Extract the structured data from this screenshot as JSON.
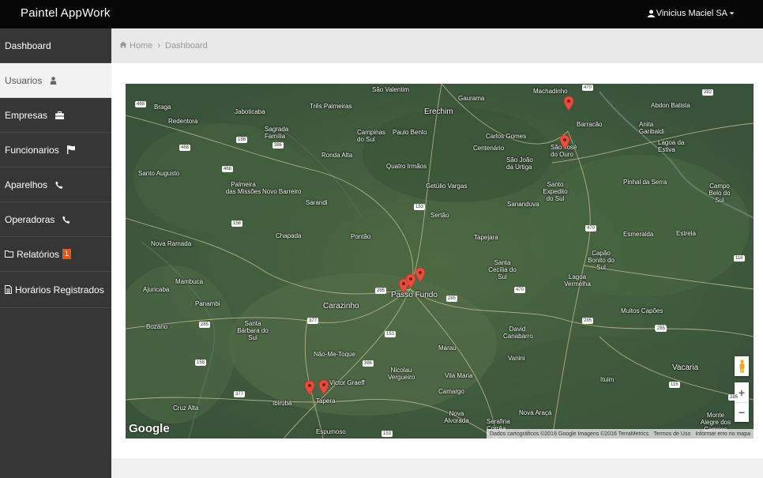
{
  "app": {
    "title": "Paintel AppWork"
  },
  "user": {
    "name": "Vinicius Maciel SA"
  },
  "sidebar": {
    "items": [
      {
        "label": "Dashboard"
      },
      {
        "label": "Usuarios"
      },
      {
        "label": "Empresas"
      },
      {
        "label": "Funcionarios"
      },
      {
        "label": "Aparelhos"
      },
      {
        "label": "Operadoras"
      },
      {
        "label": "Relatórios",
        "badge": "1"
      },
      {
        "label": "Horários Registrados"
      }
    ]
  },
  "breadcrumb": {
    "home": "Home",
    "current": "Dashboard"
  },
  "map": {
    "logo": "Google",
    "attribution": "Dados cartográficos ©2016 Google Imagens ©2016 TerraMetrics",
    "terms": "Termos de Uso",
    "report": "Informar erro no mapa",
    "zoom_in": "+",
    "zoom_out": "−",
    "places": {
      "braga": "Braga",
      "redentora": "Redentora",
      "jaboticaba": "Jaboticaba",
      "tres_palmeiras": "Três Palmeiras",
      "sao_valentim": "São Valentim",
      "gaurama": "Gaurama",
      "machadinho": "Machadinho",
      "abdon_batista": "Abdon Batista",
      "sagrada_familia": "Sagrada Família",
      "campinas_do_sul": "Campinas do Sul",
      "paulo_bento": "Paulo Bento",
      "erechim": "Erechim",
      "carlos_gomes": "Carlos Gomes",
      "centenario": "Centenário",
      "barracao": "Barracão",
      "anita_garibaldi": "Anita Garibaldi",
      "lagoa_da_estiva": "Lagoa da Estiva",
      "ronda_alta": "Ronda Alta",
      "sao_jose_do_ouro": "São José do Ouro",
      "sao_joao_da_urtiga": "São João da Urtiga",
      "quatro_irmaos": "Quatro Irmãos",
      "santo_augusto": "Santo Augusto",
      "palmeira_das_missoes": "Palmeira das Missões",
      "novo_barreiro": "Novo Barreiro",
      "sarandi": "Sarandi",
      "getulio_vargas": "Getúlio Vargas",
      "santo_expedito_do_sul": "Santo Expedito do Sul",
      "sananduva": "Sananduva",
      "pinhal_da_serra": "Pinhal da Serra",
      "campo_belo_do_sul": "Campo Belo do Sul",
      "sertao": "Sertão",
      "chapada": "Chapada",
      "pontao": "Pontão",
      "tapejara": "Tapejara",
      "esmeralda": "Esmeralda",
      "estrela": "Estrela",
      "nova_ramada": "Nova Ramada",
      "santa_cecilia_do_sul": "Santa Cecília do Sul",
      "capao_bonito_do_sul": "Capão Bonito do Sul",
      "lagoa_vermelha": "Lagoa Vermelha",
      "ajuricaba": "Ajuricaba",
      "mambuca": "Mambuca",
      "panambi": "Panambi",
      "carazinho": "Carazinho",
      "passo_fundo": "Passo Fundo",
      "muitos_capoes": "Muitos Capões",
      "bozano": "Bozano",
      "santa_barbara_do_sul": "Santa Bárbara do Sul",
      "david_canabarro": "David Canabarro",
      "marau": "Marau",
      "nao_me_toque": "Não-Me-Toque",
      "vanini": "Vanini",
      "nicolau_vergueiro": "Nicolau Vergueiro",
      "vila_maria": "Vila Maria",
      "victor_graeff": "Victor Graeff",
      "vacaria": "Vacaria",
      "ibiruba": "Ibirubá",
      "tapera": "Tapera",
      "camargo": "Camargo",
      "ituim": "Ituim",
      "cruz_alta": "Cruz Alta",
      "nova_alvorada": "Nova Alvorada",
      "serafina_correa": "Serafina Corrêa",
      "nova_araca": "Nova Araçá",
      "monte_alegre_dos_campos": "Monte Alegre dos Campos",
      "espumoso": "Espumoso"
    },
    "highways": [
      "468",
      "470",
      "282",
      "158",
      "386",
      "468",
      "468",
      "153",
      "470",
      "116",
      "158",
      "285",
      "285",
      "285",
      "470",
      "285",
      "377",
      "153",
      "470",
      "285",
      "158",
      "386",
      "116",
      "377",
      "153",
      "285"
    ]
  },
  "colors": {
    "accent": "#e8541c",
    "topbar": "#060606",
    "sidebar": "#363636",
    "marker": "#e74c3c"
  },
  "icons": [
    "user-icon",
    "caret-down-icon",
    "person-icon",
    "briefcase-icon",
    "flag-icon",
    "phone-icon",
    "folder-icon",
    "file-icon",
    "home-icon",
    "map-marker-icon",
    "pegman-icon"
  ]
}
